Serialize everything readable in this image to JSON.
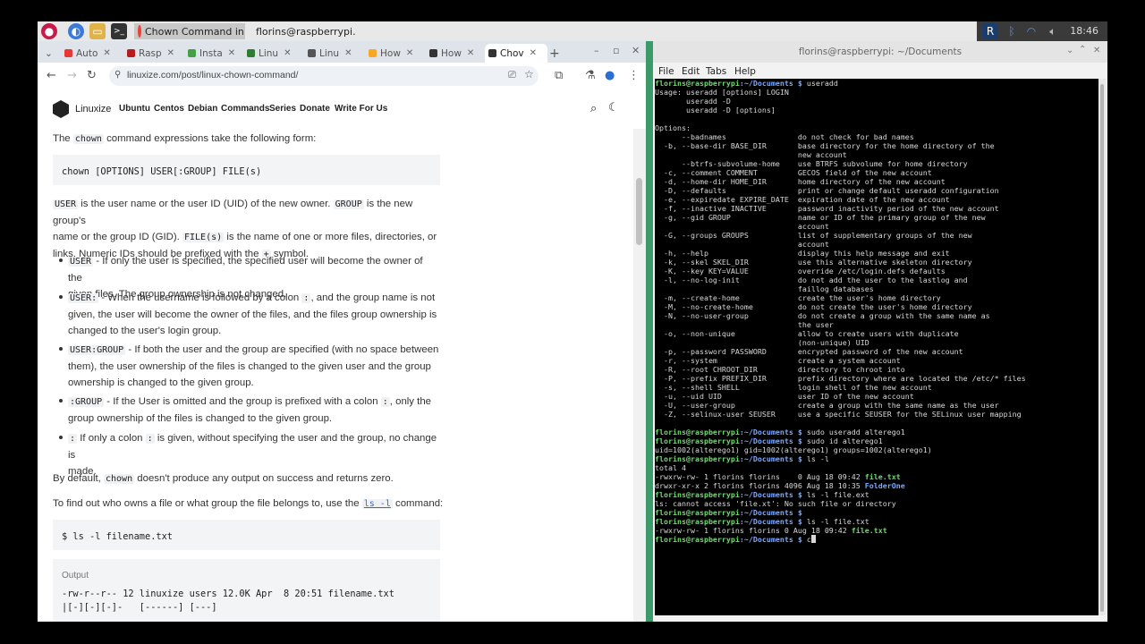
{
  "taskbar": {
    "tasks": [
      {
        "label": "Chown Command in ..."
      },
      {
        "label": "florins@raspberrypi..."
      }
    ],
    "clock": "18:46"
  },
  "browser": {
    "tabs": [
      {
        "label": "Auto",
        "color": "#e53935"
      },
      {
        "label": "Rasp",
        "color": "#b71c1c"
      },
      {
        "label": "Insta",
        "color": "#43a047"
      },
      {
        "label": "Linu",
        "color": "#2e7d32"
      },
      {
        "label": "Linu",
        "color": "#555555"
      },
      {
        "label": "How",
        "color": "#f9a825"
      },
      {
        "label": "How",
        "color": "#333333"
      },
      {
        "label": "Chov",
        "color": "#333333"
      }
    ],
    "new_tab": "+",
    "url": "linuxize.com/post/linux-chown-command/",
    "site": {
      "brand": "Linuxize",
      "nav": [
        "Ubuntu",
        "Centos",
        "Debian",
        "Commands",
        "Series",
        "Donate",
        "Write For Us"
      ]
    },
    "article": {
      "intro_a": "The",
      "intro_code": "chown",
      "intro_b": "command expressions take the following form:",
      "syntax": "chown [OPTIONS] USER[:GROUP] FILE(s)",
      "desc": {
        "c1": "USER",
        "t1": "is the user name or the user ID (UID) of the new owner.",
        "c2": "GROUP",
        "t2": "is the new group's",
        "t3": "name or the group ID (GID).",
        "c3": "FILE(s)",
        "t4": "is the name of one or more files, directories, or",
        "t5": "links. Numeric IDs should be prefixed with the",
        "c4": "+",
        "t6": "symbol."
      },
      "bullets": [
        {
          "code": "USER",
          "l1": "- If only the user is specified, the specified user will become the owner of the",
          "l2": "given files. The group ownership is not changed."
        },
        {
          "code": "USER:",
          "l1": "- When the username is followed by a colon",
          "code2": ":",
          "l1b": ", and the group name is not",
          "l2": "given, the user will become the owner of the files, and the files group ownership is",
          "l3": "changed to the user's login group."
        },
        {
          "code": "USER:GROUP",
          "l1": "- If both the user and the group are specified (with no space between",
          "l2": "them), the user ownership of the files is changed to the given user and the group",
          "l3": "ownership is changed to the given group."
        },
        {
          "code": ":GROUP",
          "l1": "- If the User is omitted and the group is prefixed with a colon",
          "code2": ":",
          "l1b": ", only the",
          "l2": "group ownership of the files is changed to the given group."
        },
        {
          "code": ":",
          "l1": "If only a colon",
          "code2": ":",
          "l1b": "is given, without specifying the user and the group, no change is",
          "l2": "made."
        }
      ],
      "default_a": "By default,",
      "default_code": "chown",
      "default_b": "doesn't produce any output on success and returns zero.",
      "find_a": "To find out who owns a file or what group the file belongs to, use the",
      "find_code": "ls -l",
      "find_b": "command:",
      "cmd": "$ ls -l filename.txt",
      "output_label": "Output",
      "output_line1": "-rw-r--r-- 12 linuxize users 12.0K Apr  8 20:51 filename.txt",
      "output_line2": "|[-][-][-]-   [------] [---]"
    }
  },
  "terminal": {
    "title": "florins@raspberrypi: ~/Documents",
    "menu": [
      "File",
      "Edit",
      "Tabs",
      "Help"
    ],
    "prompt_user": "florins@raspberrypi",
    "prompt_path": ":~/Documents $",
    "lines": [
      {
        "kind": "prompt",
        "cmd": " useradd"
      },
      {
        "kind": "text",
        "text": "Usage: useradd [options] LOGIN"
      },
      {
        "kind": "text",
        "text": "       useradd -D"
      },
      {
        "kind": "text",
        "text": "       useradd -D [options]"
      },
      {
        "kind": "text",
        "text": ""
      },
      {
        "kind": "text",
        "text": "Options:"
      },
      {
        "kind": "text",
        "text": "      --badnames                do not check for bad names"
      },
      {
        "kind": "text",
        "text": "  -b, --base-dir BASE_DIR       base directory for the home directory of the"
      },
      {
        "kind": "text",
        "text": "                                new account"
      },
      {
        "kind": "text",
        "text": "      --btrfs-subvolume-home    use BTRFS subvolume for home directory"
      },
      {
        "kind": "text",
        "text": "  -c, --comment COMMENT         GECOS field of the new account"
      },
      {
        "kind": "text",
        "text": "  -d, --home-dir HOME_DIR       home directory of the new account"
      },
      {
        "kind": "text",
        "text": "  -D, --defaults                print or change default useradd configuration"
      },
      {
        "kind": "text",
        "text": "  -e, --expiredate EXPIRE_DATE  expiration date of the new account"
      },
      {
        "kind": "text",
        "text": "  -f, --inactive INACTIVE       password inactivity period of the new account"
      },
      {
        "kind": "text",
        "text": "  -g, --gid GROUP               name or ID of the primary group of the new"
      },
      {
        "kind": "text",
        "text": "                                account"
      },
      {
        "kind": "text",
        "text": "  -G, --groups GROUPS           list of supplementary groups of the new"
      },
      {
        "kind": "text",
        "text": "                                account"
      },
      {
        "kind": "text",
        "text": "  -h, --help                    display this help message and exit"
      },
      {
        "kind": "text",
        "text": "  -k, --skel SKEL_DIR           use this alternative skeleton directory"
      },
      {
        "kind": "text",
        "text": "  -K, --key KEY=VALUE           override /etc/login.defs defaults"
      },
      {
        "kind": "text",
        "text": "  -l, --no-log-init             do not add the user to the lastlog and"
      },
      {
        "kind": "text",
        "text": "                                faillog databases"
      },
      {
        "kind": "text",
        "text": "  -m, --create-home             create the user's home directory"
      },
      {
        "kind": "text",
        "text": "  -M, --no-create-home          do not create the user's home directory"
      },
      {
        "kind": "text",
        "text": "  -N, --no-user-group           do not create a group with the same name as"
      },
      {
        "kind": "text",
        "text": "                                the user"
      },
      {
        "kind": "text",
        "text": "  -o, --non-unique              allow to create users with duplicate"
      },
      {
        "kind": "text",
        "text": "                                (non-unique) UID"
      },
      {
        "kind": "text",
        "text": "  -p, --password PASSWORD       encrypted password of the new account"
      },
      {
        "kind": "text",
        "text": "  -r, --system                  create a system account"
      },
      {
        "kind": "text",
        "text": "  -R, --root CHROOT_DIR         directory to chroot into"
      },
      {
        "kind": "text",
        "text": "  -P, --prefix PREFIX_DIR       prefix directory where are located the /etc/* files"
      },
      {
        "kind": "text",
        "text": "  -s, --shell SHELL             login shell of the new account"
      },
      {
        "kind": "text",
        "text": "  -u, --uid UID                 user ID of the new account"
      },
      {
        "kind": "text",
        "text": "  -U, --user-group              create a group with the same name as the user"
      },
      {
        "kind": "text",
        "text": "  -Z, --selinux-user SEUSER     use a specific SEUSER for the SELinux user mapping"
      },
      {
        "kind": "text",
        "text": ""
      },
      {
        "kind": "prompt",
        "cmd": " sudo useradd alterego1"
      },
      {
        "kind": "prompt",
        "cmd": " sudo id alterego1"
      },
      {
        "kind": "text",
        "text": "uid=1002(alterego1) gid=1002(alterego1) groups=1002(alterego1)"
      },
      {
        "kind": "prompt",
        "cmd": " ls -l"
      },
      {
        "kind": "text",
        "text": "total 4"
      },
      {
        "kind": "file",
        "text": "-rwxrw-rw- 1 florins florins    0 Aug 18 09:42 ",
        "name": "file.txt",
        "color": "green"
      },
      {
        "kind": "file",
        "text": "drwxr-xr-x 2 florins florins 4096 Aug 18 10:35 ",
        "name": "FolderOne",
        "color": "blue"
      },
      {
        "kind": "prompt",
        "cmd": " ls -l file.ext"
      },
      {
        "kind": "text",
        "text": "ls: cannot access 'file.xt': No such file or directory"
      },
      {
        "kind": "prompt",
        "cmd": ""
      },
      {
        "kind": "prompt",
        "cmd": " ls -l file.txt"
      },
      {
        "kind": "file",
        "text": "-rwxrw-rw- 1 florins florins 0 Aug 18 09:42 ",
        "name": "file.txt",
        "color": "green"
      },
      {
        "kind": "prompt",
        "cmd": " c",
        "cursor": true
      }
    ]
  }
}
